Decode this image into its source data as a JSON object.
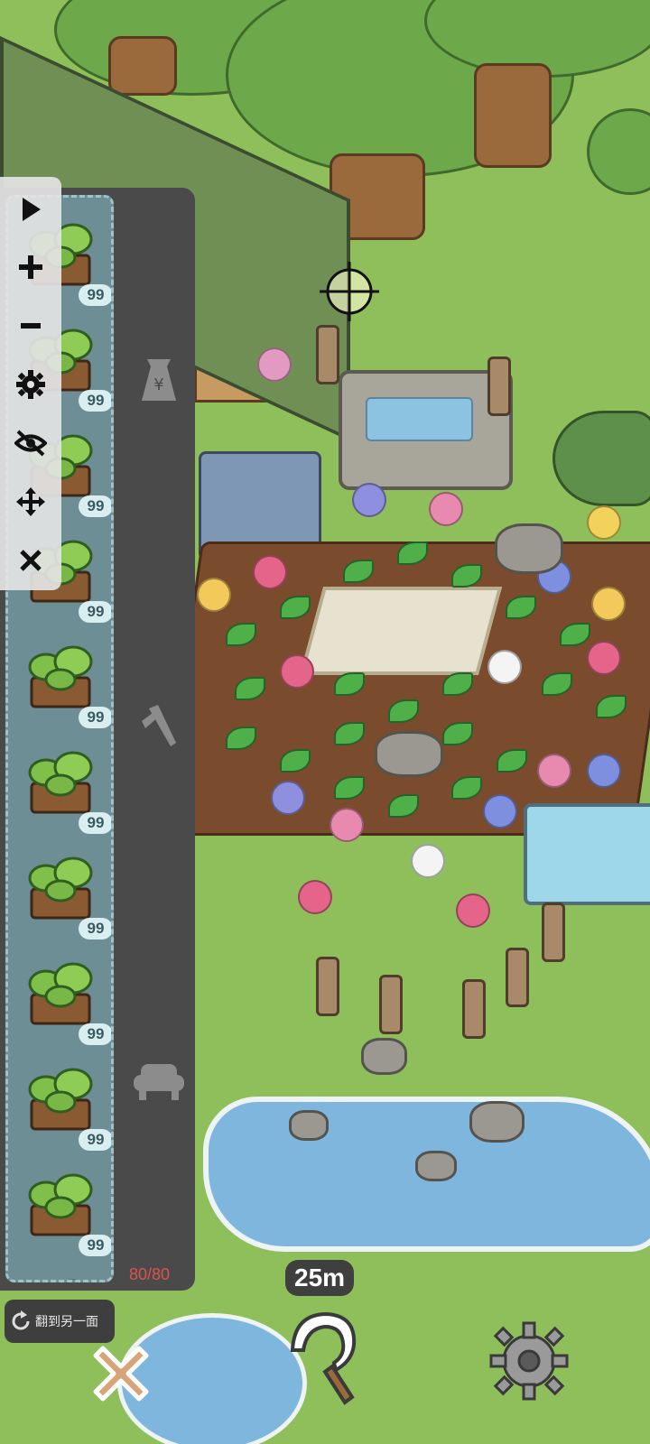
{
  "hud": {
    "distance": "25m"
  },
  "toolbar": {
    "items": [
      {
        "name": "play-icon"
      },
      {
        "name": "plus-icon"
      },
      {
        "name": "minus-icon"
      },
      {
        "name": "gear-icon"
      },
      {
        "name": "eye-off-icon"
      },
      {
        "name": "move-icon"
      },
      {
        "name": "close-icon"
      }
    ]
  },
  "inventory": {
    "items": [
      {
        "icon": "potted-vine-icon",
        "count": "99"
      },
      {
        "icon": "potted-vine-icon",
        "count": "99"
      },
      {
        "icon": "potted-vine-icon",
        "count": "99"
      },
      {
        "icon": "potted-vine-icon",
        "count": "99"
      },
      {
        "icon": "potted-vine-icon",
        "count": "99"
      },
      {
        "icon": "potted-vine-icon",
        "count": "99"
      },
      {
        "icon": "potted-vine-icon",
        "count": "99"
      },
      {
        "icon": "potted-vine-icon",
        "count": "99"
      },
      {
        "icon": "potted-vine-icon",
        "count": "99"
      },
      {
        "icon": "potted-vine-icon",
        "count": "99"
      },
      {
        "icon": "potted-vine-icon",
        "count": "99"
      }
    ],
    "capacity": "80/80"
  },
  "categories": [
    {
      "icon": "seed-bag-icon"
    },
    {
      "icon": "tool-icon"
    },
    {
      "icon": "sofa-icon"
    }
  ],
  "actions": {
    "flip_label": "翻到另一面"
  },
  "colors": {
    "panel_bg": "#4a4a4a",
    "inventory_bg": "#6d8e95",
    "badge_bg": "#d9eef1",
    "capacity_text": "#d9534f",
    "grass": "#8fbf5a"
  }
}
